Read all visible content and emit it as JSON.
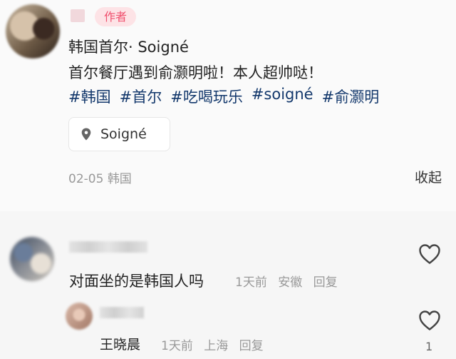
{
  "post": {
    "author_badge": "作者",
    "title": "韩国首尔· Soigné",
    "body": "首尔餐厅遇到俞灏明啦！本人超帅哒！",
    "hashtags": [
      "#韩国",
      "#首尔",
      "#吃喝玩乐",
      "#soigné",
      "#俞灏明"
    ],
    "location": "Soigné",
    "date": "02-05",
    "region": "韩国",
    "collapse_label": "收起"
  },
  "comments": [
    {
      "text": "对面坐的是韩国人吗",
      "time": "1天前",
      "location": "安徽",
      "reply_label": "回复",
      "likes": ""
    },
    {
      "text": "王晓晨",
      "time": "1天前",
      "location": "上海",
      "reply_label": "回复",
      "likes": "1"
    }
  ],
  "colors": {
    "hashtag": "#13386c",
    "badge_text": "#f0506e",
    "badge_bg": "#fde3e6",
    "meta_gray": "#999999"
  },
  "icons": {
    "location": "pin-icon",
    "like": "heart-outline-icon"
  }
}
